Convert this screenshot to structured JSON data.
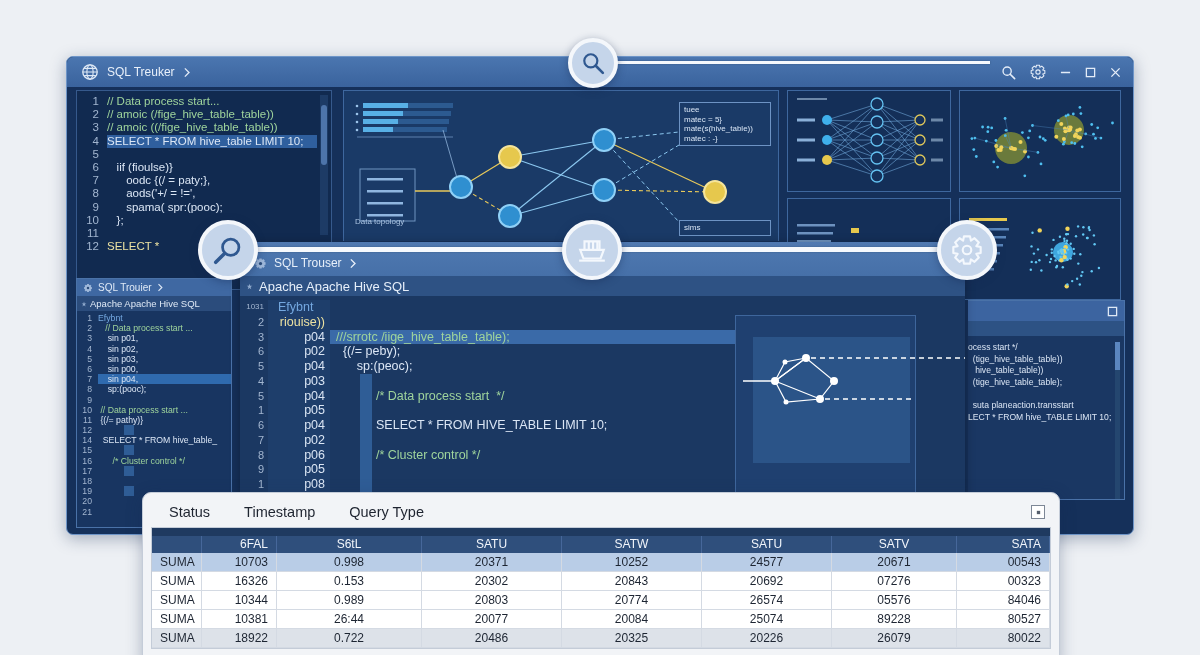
{
  "main_window": {
    "title": "SQL Treuker",
    "editor": {
      "lines": [
        {
          "number": "1",
          "text": "// Data process start...",
          "kind": "comment",
          "selected": false
        },
        {
          "number": "2",
          "text": "// amoic (/fige_hive_table_table))",
          "kind": "comment",
          "selected": false
        },
        {
          "number": "3",
          "text": "// amoic ((/fige_hive_table_table))",
          "kind": "comment",
          "selected": false
        },
        {
          "number": "4",
          "text": "SELECT * FROM hive_table LIMIT 10;",
          "kind": "code",
          "selected": true
        },
        {
          "number": "5",
          "kind": "blank",
          "selected": false
        },
        {
          "number": "6",
          "text": "   iif (fioulse)}",
          "kind": "code",
          "selected": false
        },
        {
          "number": "7",
          "text": "      oodc {(/ = paty;},",
          "kind": "code",
          "selected": false
        },
        {
          "number": "8",
          "text": "      aods('+/ = !=',",
          "kind": "code",
          "selected": false
        },
        {
          "number": "9",
          "text": "      spama( spr:(pooc);",
          "kind": "code",
          "selected": false
        },
        {
          "number": "10",
          "text": "   };",
          "kind": "code",
          "selected": false
        },
        {
          "number": "11",
          "kind": "blank",
          "selected": false
        },
        {
          "number": "12",
          "text": "SELECT *",
          "kind": "keyword",
          "selected": false
        }
      ]
    },
    "topology": {
      "label": "Data topology",
      "notes": [
        {
          "lines": [
            "tuee",
            "matec = 5}",
            "mate(s(hive_table))",
            "matec : -}"
          ]
        },
        {
          "lines": [
            "sims"
          ]
        }
      ]
    }
  },
  "left_window": {
    "title": "SQL Trouier",
    "subtitle": "Apache Apache Hive SQL",
    "lines": [
      {
        "number": "1",
        "text": "Efybnt",
        "kind": "title",
        "selected": false
      },
      {
        "number": "2",
        "text": "   // Data process start ...",
        "kind": "comment",
        "selected": false
      },
      {
        "number": "3",
        "text": "    sin p01,",
        "kind": "code",
        "selected": false
      },
      {
        "number": "4",
        "text": "    sin p02,",
        "kind": "code",
        "selected": false
      },
      {
        "number": "5",
        "text": "    sin p03,",
        "kind": "code",
        "selected": false
      },
      {
        "number": "6",
        "text": "    sin p00,",
        "kind": "code",
        "selected": false
      },
      {
        "number": "7",
        "text": "    sin p04,",
        "kind": "code",
        "selected": true
      },
      {
        "number": "8",
        "text": "    sp:(pooc);",
        "kind": "code",
        "selected": false
      },
      {
        "number": "9",
        "kind": "blank",
        "selected": false
      },
      {
        "number": "10",
        "text": " // Data process start ...",
        "kind": "comment",
        "selected": false
      },
      {
        "number": "11",
        "text": " {(/= pathy)}",
        "kind": "code",
        "selected": false
      },
      {
        "number": "12",
        "kind": "block",
        "selected": false
      },
      {
        "number": "14",
        "text": "  SELECT * FROM hive_table_",
        "kind": "code",
        "selected": false
      },
      {
        "number": "15",
        "kind": "block",
        "selected": false
      },
      {
        "number": "16",
        "text": "      /* Cluster control */",
        "kind": "comment",
        "selected": false
      },
      {
        "number": "17",
        "kind": "block",
        "selected": false
      },
      {
        "number": "18",
        "kind": "blank",
        "selected": false
      },
      {
        "number": "19",
        "kind": "block",
        "selected": false
      },
      {
        "number": "20",
        "kind": "blank",
        "selected": false
      },
      {
        "number": "21",
        "kind": "blank",
        "selected": false
      }
    ]
  },
  "center_window": {
    "title": "SQL Trouser",
    "subtitle": "Apache Apache Hive SQL",
    "rows": [
      {
        "number": "1031",
        "marker": "Efybnt",
        "kind": "title",
        "block": false,
        "selected": false
      },
      {
        "number": "2",
        "marker": "riouise))",
        "kind": "keyword",
        "block": false,
        "selected": false
      },
      {
        "number": "3",
        "marker": "p04",
        "code": "///srrotc /iige_hive_table_table);",
        "kind": "comment",
        "block": false,
        "selected": true
      },
      {
        "number": "6",
        "marker": "p02",
        "code": "  {(/= peby);",
        "kind": "code",
        "block": false,
        "selected": false
      },
      {
        "number": "5",
        "marker": "p04",
        "code": "      sp:(peoc);",
        "kind": "code",
        "block": false,
        "selected": false
      },
      {
        "number": "4",
        "marker": "p03",
        "kind": "code",
        "block": true,
        "selected": false
      },
      {
        "number": "5",
        "marker": "p04",
        "code": "/* Data process start  */",
        "kind": "comment",
        "block": true,
        "selected": false
      },
      {
        "number": "1",
        "marker": "p05",
        "kind": "code",
        "block": true,
        "selected": false
      },
      {
        "number": "6",
        "marker": "p04",
        "code": "SELECT * FROM HIVE_TABLE LIMIT 10;",
        "kind": "code",
        "block": true,
        "selected": false
      },
      {
        "number": "7",
        "marker": "p02",
        "kind": "code",
        "block": true,
        "selected": false
      },
      {
        "number": "8",
        "marker": "p06",
        "code": "/* Cluster control */",
        "kind": "comment",
        "block": true,
        "selected": false
      },
      {
        "number": "9",
        "marker": "p05",
        "kind": "code",
        "block": true,
        "selected": false
      },
      {
        "number": "1",
        "marker": "p08",
        "kind": "code",
        "block": true,
        "selected": false
      }
    ]
  },
  "right_window": {
    "lines": [
      {
        "text": "ocess start */",
        "kind": "code"
      },
      {
        "text": "  (tige_hive_table_table))",
        "kind": "code"
      },
      {
        "text": "   hive_table_table))",
        "kind": "code"
      },
      {
        "text": "  (tige_hive_table_table);",
        "kind": "code"
      },
      {
        "kind": "blank"
      },
      {
        "text": "  suta planeaction.transstart",
        "kind": "code"
      },
      {
        "text": "LECT * FROM hive_TABLE LIMIT 10;",
        "kind": "code"
      }
    ]
  },
  "results": {
    "tabs": [
      {
        "label": "Status",
        "selected": false
      },
      {
        "label": "Timestamp",
        "selected": false
      },
      {
        "label": "Query Type",
        "selected": false
      }
    ],
    "columns": [
      "6FAL",
      "S6tL",
      "SATU",
      "SATW",
      "SATU",
      "SATV",
      "SATA"
    ],
    "rows": [
      {
        "label": "SUMA",
        "cells": [
          "10703",
          "0.998",
          "20371",
          "10252",
          "24577",
          "20671",
          "00543"
        ],
        "selected": true,
        "shaded": false
      },
      {
        "label": "SUMA",
        "cells": [
          "16326",
          "0.153",
          "20302",
          "20843",
          "20692",
          "07276",
          "00323"
        ],
        "selected": false,
        "shaded": false
      },
      {
        "label": "SUMA",
        "cells": [
          "10344",
          "0.989",
          "20803",
          "20774",
          "26574",
          "05576",
          "84046"
        ],
        "selected": false,
        "shaded": false
      },
      {
        "label": "SUMA",
        "cells": [
          "10381",
          "26:44",
          "20077",
          "20084",
          "25074",
          "89228",
          "80527"
        ],
        "selected": false,
        "shaded": false
      },
      {
        "label": "SUMA",
        "cells": [
          "18922",
          "0.722",
          "20486",
          "20325",
          "20226",
          "26079",
          "80022"
        ],
        "selected": false,
        "shaded": true
      }
    ]
  }
}
